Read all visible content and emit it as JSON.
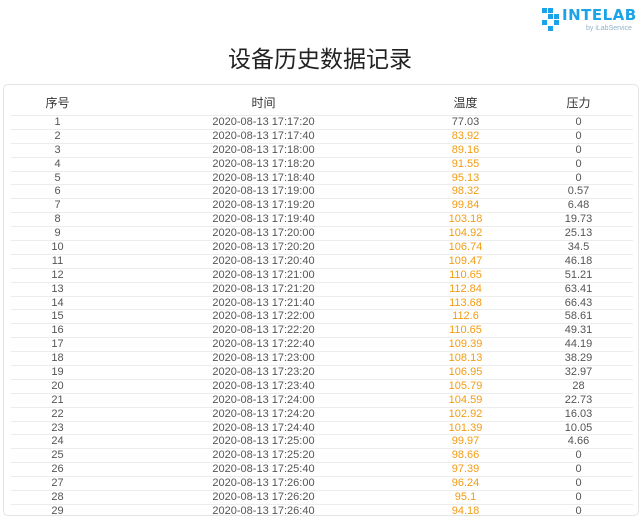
{
  "logo": {
    "brand": "INTELAB",
    "sub": "by iLabService"
  },
  "title": "设备历史数据记录",
  "table": {
    "headers": [
      "序号",
      "时间",
      "温度",
      "压力"
    ],
    "highlight_color": "#f39c12",
    "rows": [
      {
        "idx": "1",
        "time": "2020-08-13 17:17:20",
        "temp": "77.03",
        "pres": "0",
        "hot": false
      },
      {
        "idx": "2",
        "time": "2020-08-13 17:17:40",
        "temp": "83.92",
        "pres": "0",
        "hot": true
      },
      {
        "idx": "3",
        "time": "2020-08-13 17:18:00",
        "temp": "89.16",
        "pres": "0",
        "hot": true
      },
      {
        "idx": "4",
        "time": "2020-08-13 17:18:20",
        "temp": "91.55",
        "pres": "0",
        "hot": true
      },
      {
        "idx": "5",
        "time": "2020-08-13 17:18:40",
        "temp": "95.13",
        "pres": "0",
        "hot": true
      },
      {
        "idx": "6",
        "time": "2020-08-13 17:19:00",
        "temp": "98.32",
        "pres": "0.57",
        "hot": true
      },
      {
        "idx": "7",
        "time": "2020-08-13 17:19:20",
        "temp": "99.84",
        "pres": "6.48",
        "hot": true
      },
      {
        "idx": "8",
        "time": "2020-08-13 17:19:40",
        "temp": "103.18",
        "pres": "19.73",
        "hot": true
      },
      {
        "idx": "9",
        "time": "2020-08-13 17:20:00",
        "temp": "104.92",
        "pres": "25.13",
        "hot": true
      },
      {
        "idx": "10",
        "time": "2020-08-13 17:20:20",
        "temp": "106.74",
        "pres": "34.5",
        "hot": true
      },
      {
        "idx": "11",
        "time": "2020-08-13 17:20:40",
        "temp": "109.47",
        "pres": "46.18",
        "hot": true
      },
      {
        "idx": "12",
        "time": "2020-08-13 17:21:00",
        "temp": "110.65",
        "pres": "51.21",
        "hot": true
      },
      {
        "idx": "13",
        "time": "2020-08-13 17:21:20",
        "temp": "112.84",
        "pres": "63.41",
        "hot": true
      },
      {
        "idx": "14",
        "time": "2020-08-13 17:21:40",
        "temp": "113.68",
        "pres": "66.43",
        "hot": true
      },
      {
        "idx": "15",
        "time": "2020-08-13 17:22:00",
        "temp": "112.6",
        "pres": "58.61",
        "hot": true
      },
      {
        "idx": "16",
        "time": "2020-08-13 17:22:20",
        "temp": "110.65",
        "pres": "49.31",
        "hot": true
      },
      {
        "idx": "17",
        "time": "2020-08-13 17:22:40",
        "temp": "109.39",
        "pres": "44.19",
        "hot": true
      },
      {
        "idx": "18",
        "time": "2020-08-13 17:23:00",
        "temp": "108.13",
        "pres": "38.29",
        "hot": true
      },
      {
        "idx": "19",
        "time": "2020-08-13 17:23:20",
        "temp": "106.95",
        "pres": "32.97",
        "hot": true
      },
      {
        "idx": "20",
        "time": "2020-08-13 17:23:40",
        "temp": "105.79",
        "pres": "28",
        "hot": true
      },
      {
        "idx": "21",
        "time": "2020-08-13 17:24:00",
        "temp": "104.59",
        "pres": "22.73",
        "hot": true
      },
      {
        "idx": "22",
        "time": "2020-08-13 17:24:20",
        "temp": "102.92",
        "pres": "16.03",
        "hot": true
      },
      {
        "idx": "23",
        "time": "2020-08-13 17:24:40",
        "temp": "101.39",
        "pres": "10.05",
        "hot": true
      },
      {
        "idx": "24",
        "time": "2020-08-13 17:25:00",
        "temp": "99.97",
        "pres": "4.66",
        "hot": true
      },
      {
        "idx": "25",
        "time": "2020-08-13 17:25:20",
        "temp": "98.66",
        "pres": "0",
        "hot": true
      },
      {
        "idx": "26",
        "time": "2020-08-13 17:25:40",
        "temp": "97.39",
        "pres": "0",
        "hot": true
      },
      {
        "idx": "27",
        "time": "2020-08-13 17:26:00",
        "temp": "96.24",
        "pres": "0",
        "hot": true
      },
      {
        "idx": "28",
        "time": "2020-08-13 17:26:20",
        "temp": "95.1",
        "pres": "0",
        "hot": true
      },
      {
        "idx": "29",
        "time": "2020-08-13 17:26:40",
        "temp": "94.18",
        "pres": "0",
        "hot": true
      }
    ]
  }
}
